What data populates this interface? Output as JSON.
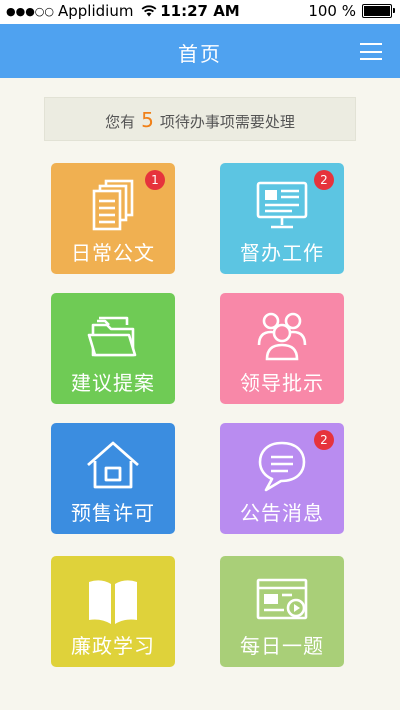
{
  "status_bar": {
    "signal": "●●●○○",
    "carrier": "Applidium",
    "time": "11:27 AM",
    "battery": "100 %"
  },
  "header": {
    "title": "首页",
    "menu_icon": "hamburger-menu-icon"
  },
  "notice": {
    "prefix": "您有",
    "count": "5",
    "suffix": "项待办事项需要处理"
  },
  "tiles": [
    {
      "label": "日常公文",
      "badge": "1",
      "color": "#f0b051",
      "icon": "document-stack-icon"
    },
    {
      "label": "督办工作",
      "badge": "2",
      "color": "#5cc5e2",
      "icon": "monitor-icon"
    },
    {
      "label": "建议提案",
      "badge": "",
      "color": "#6fcb55",
      "icon": "folder-icon"
    },
    {
      "label": "领导批示",
      "badge": "",
      "color": "#f888a8",
      "icon": "people-icon"
    },
    {
      "label": "预售许可",
      "badge": "",
      "color": "#3b8de0",
      "icon": "house-icon"
    },
    {
      "label": "公告消息",
      "badge": "2",
      "color": "#b98cf0",
      "icon": "chat-bubble-icon"
    },
    {
      "label": "廉政学习",
      "badge": "",
      "color": "#dfd23a",
      "icon": "open-book-icon"
    },
    {
      "label": "每日一题",
      "badge": "",
      "color": "#a9cf78",
      "icon": "video-screen-icon"
    }
  ]
}
